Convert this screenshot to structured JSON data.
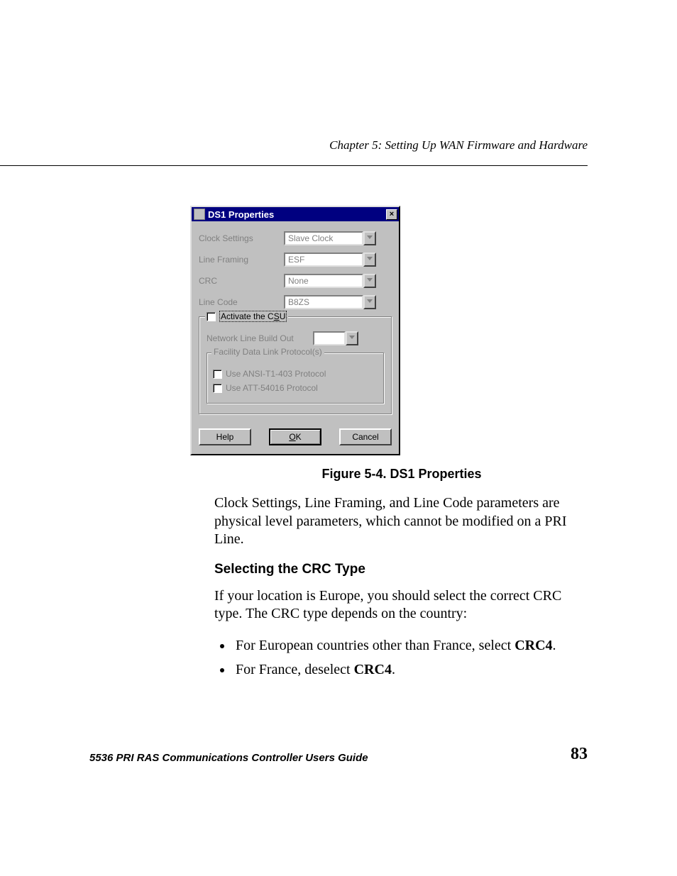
{
  "header": {
    "chapter": "Chapter 5: Setting Up WAN Firmware and Hardware"
  },
  "dialog": {
    "title": "DS1 Properties",
    "fields": {
      "clock": {
        "label": "Clock Settings",
        "value": "Slave Clock"
      },
      "framing": {
        "label": "Line Framing",
        "value": "ESF"
      },
      "crc": {
        "label": "CRC",
        "value": "None"
      },
      "linecode": {
        "label": "Line Code",
        "value": "B8ZS"
      }
    },
    "csu": {
      "legend": "Activate the CSU",
      "nlbo_label": "Network Line Build Out",
      "nlbo_value": "",
      "fdlp_legend": "Facility Data Link Protocol(s)",
      "ansi": "Use ANSI-T1-403 Protocol",
      "att": "Use ATT-54016 Protocol"
    },
    "buttons": {
      "help": "Help",
      "ok": "OK",
      "cancel": "Cancel"
    }
  },
  "figure": {
    "caption": "Figure 5-4.  DS1 Properties"
  },
  "body": {
    "p1": "Clock Settings, Line Framing, and Line Code parameters are physical level parameters, which cannot be modified on a PRI Line.",
    "h3": "Selecting the CRC Type",
    "p2": "If your location is Europe, you should select the correct CRC type. The CRC type depends on the country:",
    "li1a": "For European countries other than France, select ",
    "li1b": "CRC4",
    "li1c": ".",
    "li2a": "For France, deselect ",
    "li2b": "CRC4",
    "li2c": "."
  },
  "footer": {
    "guide": "5536 PRI RAS Communications Controller Users Guide",
    "page": "83"
  }
}
